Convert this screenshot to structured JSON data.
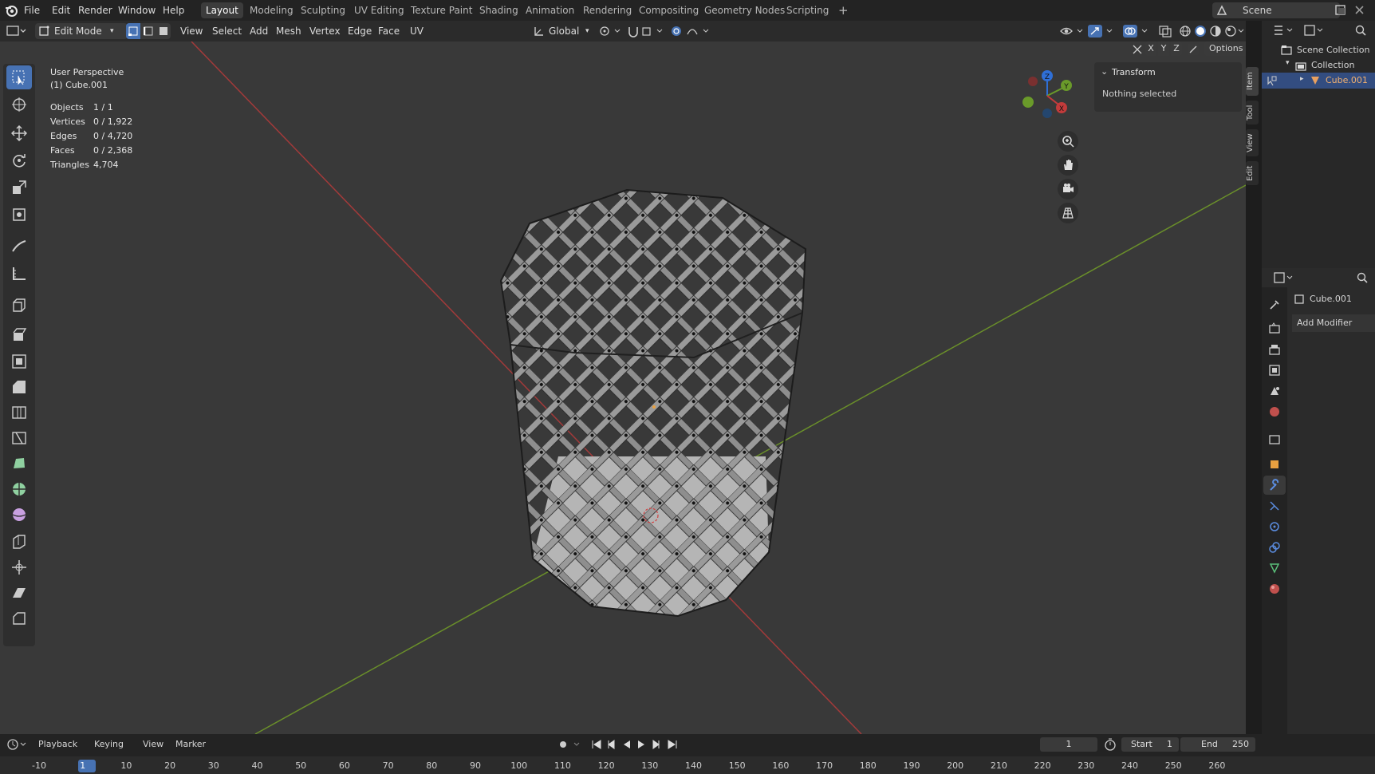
{
  "menu": [
    "File",
    "Edit",
    "Render",
    "Window",
    "Help"
  ],
  "workspaces": [
    "Layout",
    "Modeling",
    "Sculpting",
    "UV Editing",
    "Texture Paint",
    "Shading",
    "Animation",
    "Rendering",
    "Compositing",
    "Geometry Nodes",
    "Scripting"
  ],
  "add_workspace": "+",
  "scene_name": "Scene",
  "header": {
    "mode": "Edit Mode",
    "menus": [
      "View",
      "Select",
      "Add",
      "Mesh",
      "Vertex",
      "Edge",
      "Face",
      "UV"
    ],
    "orientation": "Global",
    "options": "Options",
    "axes": [
      "X",
      "Y",
      "Z"
    ]
  },
  "overlay": {
    "view_name": "User Perspective",
    "object_name": "(1) Cube.001",
    "stats": [
      {
        "label": "Objects",
        "value": "1 / 1"
      },
      {
        "label": "Vertices",
        "value": "0 / 1,922"
      },
      {
        "label": "Edges",
        "value": "0 / 4,720"
      },
      {
        "label": "Faces",
        "value": "0 / 2,368"
      },
      {
        "label": "Triangles",
        "value": "4,704"
      }
    ]
  },
  "gizmo": {
    "x": "X",
    "y": "Y",
    "z": "Z"
  },
  "npanel": {
    "title": "Transform",
    "message": "Nothing selected",
    "tabs": [
      "Item",
      "Tool",
      "View",
      "Edit"
    ]
  },
  "outliner": {
    "scene_collection": "Scene Collection",
    "collection": "Collection",
    "object": "Cube.001"
  },
  "properties": {
    "object": "Cube.001",
    "add_modifier": "Add Modifier"
  },
  "timeline": {
    "menus": [
      "Playback",
      "Keying",
      "View",
      "Marker"
    ],
    "current_frame": "1",
    "start_label": "Start",
    "start": "1",
    "end_label": "End",
    "end": "250",
    "ruler": [
      "-10",
      "1",
      "10",
      "20",
      "30",
      "40",
      "50",
      "60",
      "70",
      "80",
      "90",
      "100",
      "110",
      "120",
      "130",
      "140",
      "150",
      "160",
      "170",
      "180",
      "190",
      "200",
      "210",
      "220",
      "230",
      "240",
      "250",
      "260"
    ]
  },
  "colors": {
    "accent": "#4772b3",
    "x_axis": "#c23b3b",
    "y_axis": "#6a9a2a",
    "z_axis": "#2f6fd6"
  }
}
